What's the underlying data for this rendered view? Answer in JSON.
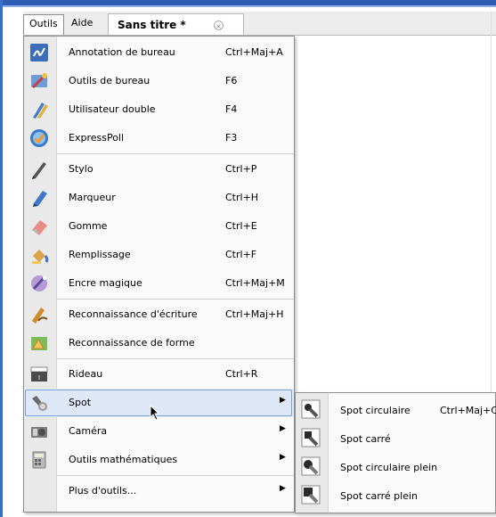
{
  "menubar": {
    "outils": "Outils",
    "aide": "Aide",
    "doc_tab": "Sans titre *",
    "close_glyph": "×"
  },
  "menu": {
    "items": [
      {
        "label": "Annotation de bureau",
        "shortcut": "Ctrl+Maj+A",
        "icon": "annotation-icon"
      },
      {
        "label": "Outils de bureau",
        "shortcut": "F6",
        "icon": "desktop-tools-icon"
      },
      {
        "label": "Utilisateur double",
        "shortcut": "F4",
        "icon": "dual-user-icon"
      },
      {
        "label": "ExpressPoll",
        "shortcut": "F3",
        "icon": "expresspoll-icon"
      },
      {
        "label": "Stylo",
        "shortcut": "Ctrl+P",
        "icon": "pen-icon"
      },
      {
        "label": "Marqueur",
        "shortcut": "Ctrl+H",
        "icon": "marker-icon"
      },
      {
        "label": "Gomme",
        "shortcut": "Ctrl+E",
        "icon": "eraser-icon"
      },
      {
        "label": "Remplissage",
        "shortcut": "Ctrl+F",
        "icon": "fill-icon"
      },
      {
        "label": "Encre magique",
        "shortcut": "Ctrl+Maj+M",
        "icon": "magic-ink-icon"
      },
      {
        "label": "Reconnaissance d'écriture",
        "shortcut": "Ctrl+Maj+H",
        "icon": "handwriting-recognition-icon"
      },
      {
        "label": "Reconnaissance de forme",
        "shortcut": "",
        "icon": "shape-recognition-icon"
      },
      {
        "label": "Rideau",
        "shortcut": "Ctrl+R",
        "icon": "curtain-icon"
      },
      {
        "label": "Spot",
        "shortcut": "",
        "icon": "spotlight-icon",
        "submenu": true,
        "selected": true
      },
      {
        "label": "Caméra",
        "shortcut": "",
        "icon": "camera-icon",
        "submenu": true
      },
      {
        "label": "Outils mathématiques",
        "shortcut": "",
        "icon": "calculator-icon",
        "submenu": true
      },
      {
        "label": "Plus d'outils...",
        "shortcut": "",
        "icon": "",
        "submenu": true
      }
    ]
  },
  "submenu": {
    "items": [
      {
        "label": "Spot circulaire",
        "shortcut": "Ctrl+Maj+C",
        "icon": "spot-circular-icon"
      },
      {
        "label": "Spot carré",
        "shortcut": "",
        "icon": "spot-square-icon"
      },
      {
        "label": "Spot circulaire plein",
        "shortcut": "",
        "icon": "spot-circular-full-icon"
      },
      {
        "label": "Spot carré plein",
        "shortcut": "",
        "icon": "spot-square-full-icon"
      }
    ]
  },
  "submenu_arrow": "▶"
}
